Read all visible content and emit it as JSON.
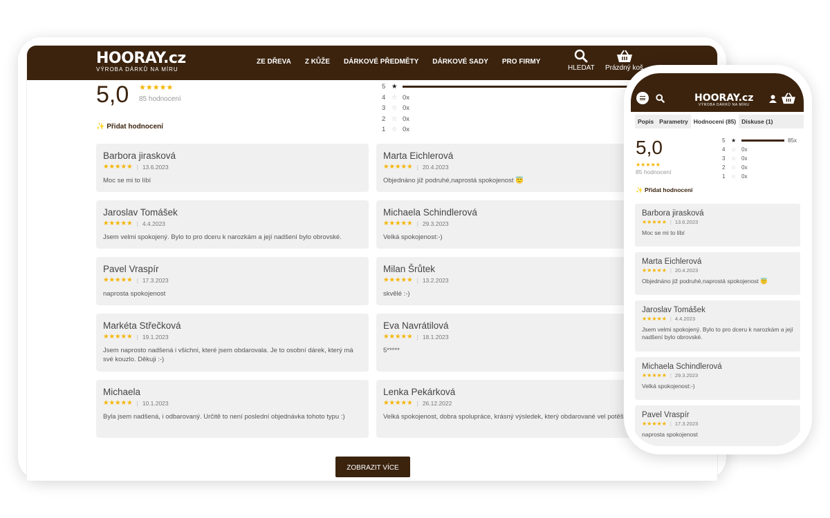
{
  "brand": {
    "name": "HOORAY.cz",
    "tagline": "VÝROBA DÁRKŮ NA MÍRU"
  },
  "nav": {
    "items": [
      "ZE DŘEVA",
      "Z KŮŽE",
      "DÁRKOVÉ PŘEDMĚTY",
      "DÁRKOVÉ SADY",
      "PRO FIRMY"
    ],
    "search_label": "HLEDAT",
    "cart_label": "Prázdný koš"
  },
  "summary": {
    "average": "5,0",
    "stars": "★★★★★",
    "count_label": "85 hodnocení",
    "add_review": "Přidat hodnocení"
  },
  "distribution": [
    {
      "level": "5",
      "value": "85x",
      "fraction": 1.0
    },
    {
      "level": "4",
      "value": "0x",
      "fraction": 0
    },
    {
      "level": "3",
      "value": "0x",
      "fraction": 0
    },
    {
      "level": "2",
      "value": "0x",
      "fraction": 0
    },
    {
      "level": "1",
      "value": "0x",
      "fraction": 0
    }
  ],
  "reviews": [
    {
      "name": "Barbora jirasková",
      "date": "13.6.2023",
      "text": "Moc se mi to líbí"
    },
    {
      "name": "Marta Eichlerová",
      "date": "20.4.2023",
      "text": "Objednáno již podruhé,naprostá spokojenost 😇"
    },
    {
      "name": "Jaroslav Tomášek",
      "date": "4.4.2023",
      "text": "Jsem velmi spokojený. Bylo to pro dceru k narozkám a její nadšení bylo obrovské."
    },
    {
      "name": "Michaela Schindlerová",
      "date": "29.3.2023",
      "text": "Velká spokojenost:-)"
    },
    {
      "name": "Pavel Vraspír",
      "date": "17.3.2023",
      "text": "naprosta spokojenost"
    },
    {
      "name": "Milan Šrůtek",
      "date": "13.2.2023",
      "text": "skvělé :-)"
    },
    {
      "name": "Markéta Střečková",
      "date": "19.1.2023",
      "text": "Jsem naprosto nadšená i všichni, které jsem obdarovala. Je to osobní dárek, který má své kouzlo. Děkuji :-)"
    },
    {
      "name": "Eva Navrátilová",
      "date": "18.1.2023",
      "text": "5*****"
    },
    {
      "name": "Michaela",
      "date": "10.1.2023",
      "text": "Byla jsem nadšená, i odbarovaný. Určitě to není poslední objednávka tohoto typu :)"
    },
    {
      "name": "Lenka Pekárková",
      "date": "26.12.2022",
      "text": "Velká spokojenost, dobra spolupráce, krásný výsledek, který obdarované vel potěšil!!!!"
    }
  ],
  "more_button": "ZOBRAZIT VÍCE",
  "mobile": {
    "tabs": [
      "Popis",
      "Parametry",
      "Hodnocení (85)",
      "Diskuse (1)"
    ],
    "active_tab": "Hodnocení (85)",
    "reviews": [
      {
        "name": "Barbora jirasková",
        "date": "13.6.2023",
        "text": "Moc se mi to líbí"
      },
      {
        "name": "Marta Eichlerová",
        "date": "20.4.2023",
        "text": "Objednáno již podruhé,naprostá spokojenost 😇"
      },
      {
        "name": "Jaroslav Tomášek",
        "date": "4.4.2023",
        "text": "Jsem velmi spokojený. Bylo to pro dceru k narozkám a její nadšení bylo obrovské."
      },
      {
        "name": "Michaela Schindlerová",
        "date": "29.3.2023",
        "text": "Velká spokojenost:-)"
      },
      {
        "name": "Pavel Vraspír",
        "date": "17.3.2023",
        "text": "naprosta spokojenost"
      }
    ]
  },
  "colors": {
    "brand_brown": "#3b230e",
    "star_gold": "#f5b400",
    "card_bg": "#f0f0f0"
  },
  "icons": {
    "search": "search-icon",
    "cart": "basket-icon",
    "user": "user-icon",
    "menu": "hamburger-icon",
    "add": "sparkle-icon"
  }
}
